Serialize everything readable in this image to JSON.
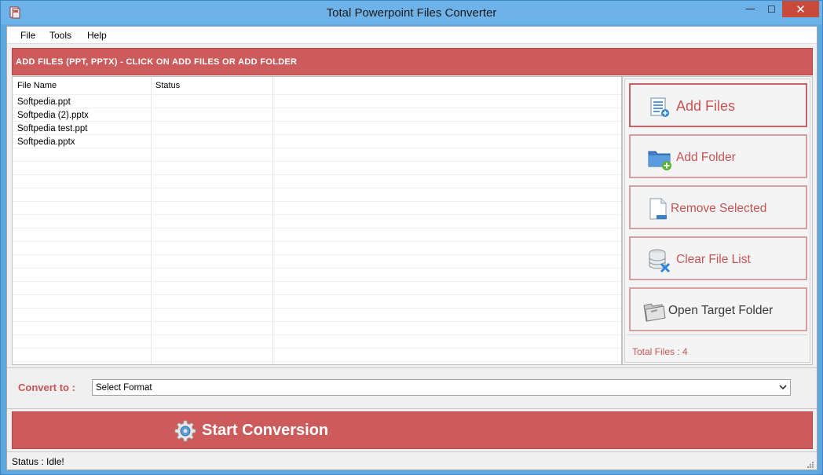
{
  "window": {
    "title": "Total Powerpoint Files Converter",
    "minimize": "—",
    "maximize": "☐",
    "close": "✕"
  },
  "menu": {
    "items": [
      "File",
      "Tools",
      "Help"
    ]
  },
  "header": {
    "text": "ADD FILES (PPT, PPTX) - CLICK ON ADD FILES OR ADD FOLDER"
  },
  "file_list": {
    "columns": [
      "File Name",
      "Status"
    ],
    "rows": [
      {
        "name": "Softpedia.ppt",
        "status": ""
      },
      {
        "name": "Softpedia (2).pptx",
        "status": ""
      },
      {
        "name": "Softpedia test.ppt",
        "status": ""
      },
      {
        "name": "Softpedia.pptx",
        "status": ""
      }
    ]
  },
  "actions": {
    "add_files": "Add Files",
    "add_folder": "Add Folder",
    "remove_selected": "Remove Selected",
    "clear_file_list": "Clear File List",
    "open_target_folder": "Open Target Folder",
    "total_files": "Total Files : 4"
  },
  "convert": {
    "label": "Convert to :",
    "selected": "Select Format"
  },
  "start": {
    "label": "Start Conversion"
  },
  "status": {
    "text": "Status  :  Idle!"
  },
  "colors": {
    "accent": "#cd5b5b",
    "accent_text": "#c65454",
    "titlebar": "#6db3ea",
    "close": "#c74a3b"
  }
}
